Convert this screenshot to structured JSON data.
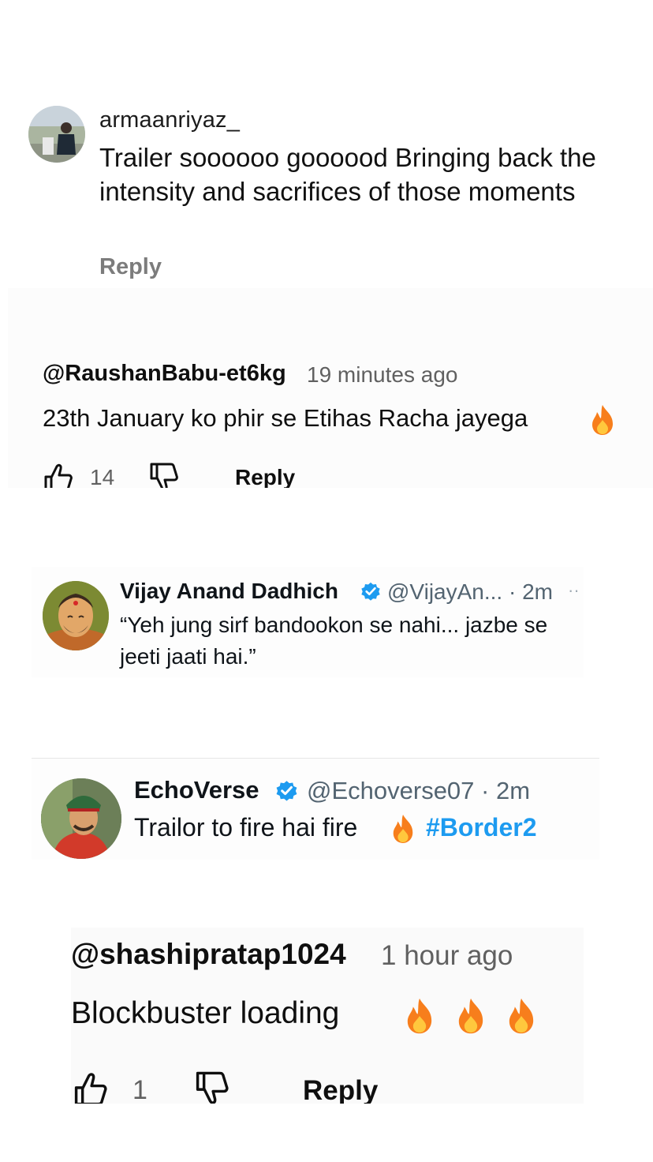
{
  "instagram_comment": {
    "username": "armaanriyaz_",
    "text": "Trailer soooooo goooood Bringing back the intensity and sacrifices of those moments",
    "reply_label": "Reply"
  },
  "youtube_comment_1": {
    "username": "@RaushanBabu-et6kg",
    "time": "19 minutes ago",
    "text": "23th January ko phir se Etihas Racha jayega",
    "like_count": "14",
    "reply_label": "Reply"
  },
  "x_post_1": {
    "name": "Vijay Anand Dadhich",
    "handle_time": "@VijayAn... · 2m",
    "more": "··",
    "text": "“Yeh jung sirf bandookon se nahi... jazbe se jeeti jaati hai.”"
  },
  "x_post_2": {
    "name": "EchoVerse",
    "handle_time": "@Echoverse07 · 2m",
    "text": "Trailor to fire hai fire",
    "hashtag": "#Border2"
  },
  "youtube_comment_2": {
    "username": "@shashipratap1024",
    "time": "1 hour ago",
    "text": "Blockbuster loading",
    "like_count": "1",
    "reply_label": "Reply"
  },
  "colors": {
    "verified": "#1d9bf0",
    "hashtag": "#1d9bf0",
    "muted": "#606060"
  },
  "icons": [
    "fire-emoji",
    "thumbs-up-icon",
    "thumbs-down-icon",
    "verified-badge-icon"
  ]
}
